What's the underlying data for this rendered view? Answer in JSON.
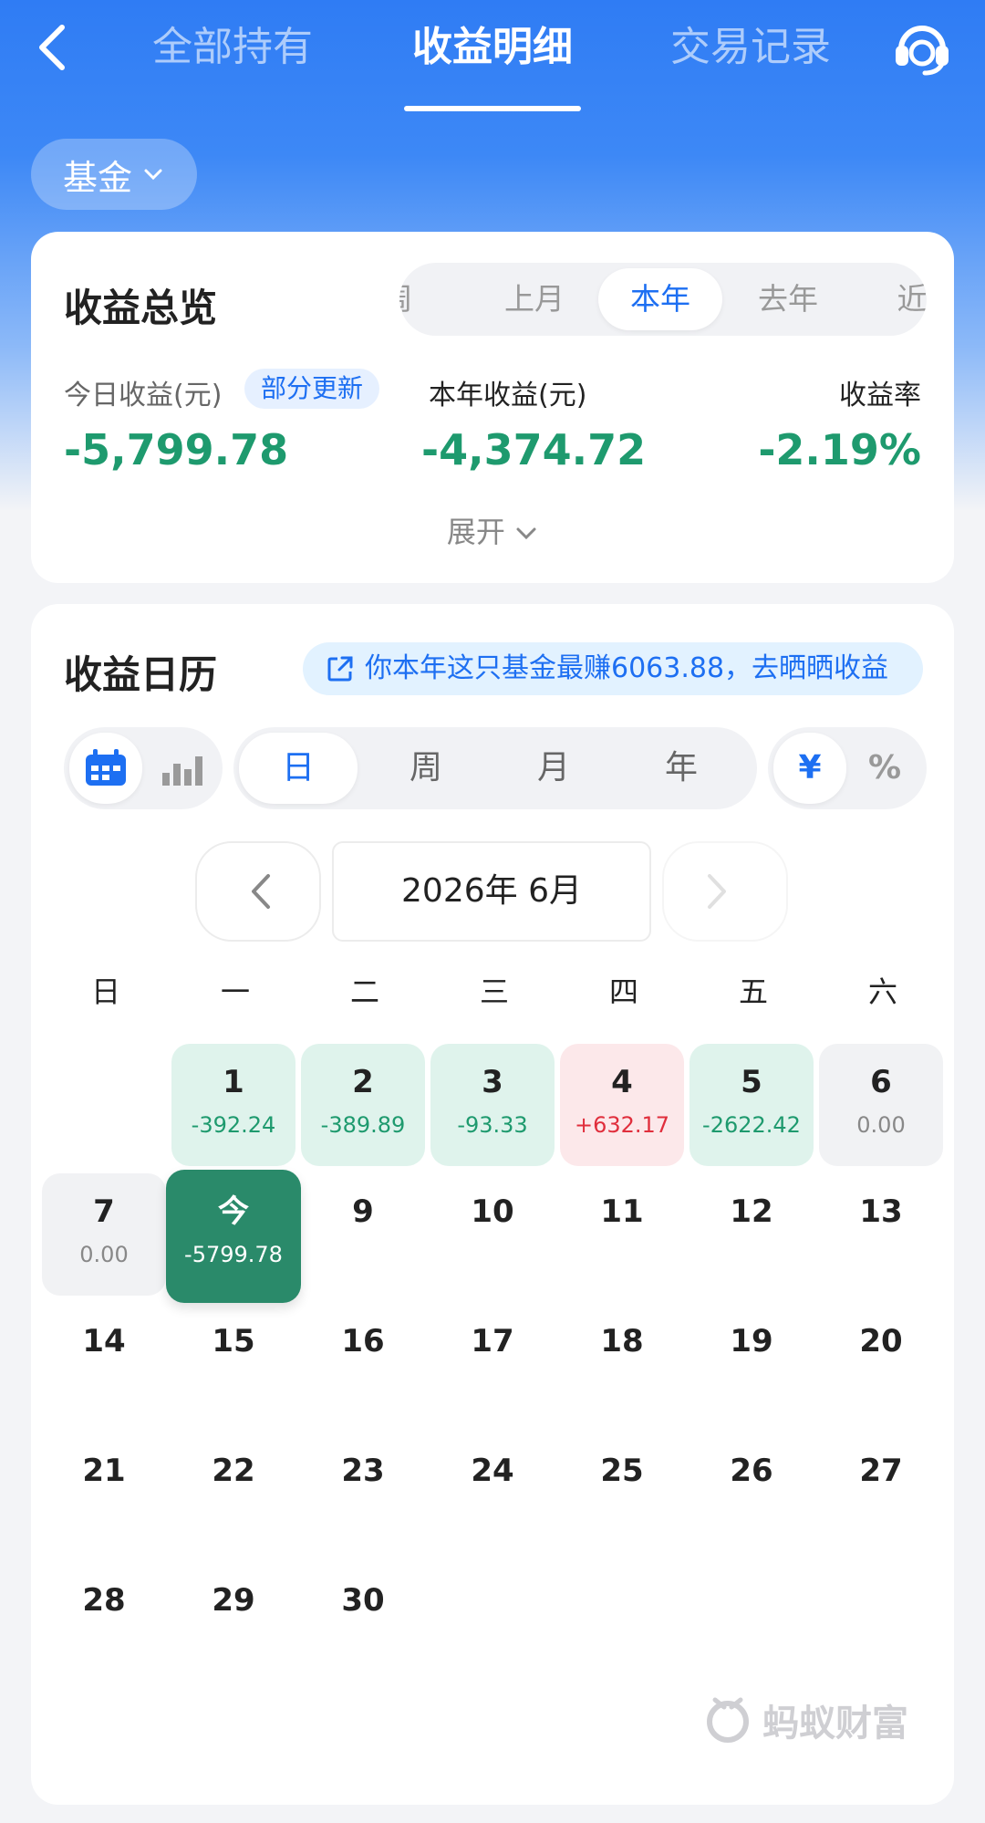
{
  "nav": {
    "tabs": [
      "全部持有",
      "收益明细",
      "交易记录"
    ],
    "active_tab": "收益明细"
  },
  "filter": {
    "label": "基金"
  },
  "overview": {
    "title": "收益总览",
    "periods": [
      "周",
      "上月",
      "本年",
      "去年",
      "近"
    ],
    "active_period": "本年",
    "today_label": "今日收益(元)",
    "badge": "部分更新",
    "today_value": "-5,799.78",
    "year_label": "本年收益(元)",
    "year_value": "-4,374.72",
    "rate_label": "收益率",
    "rate_value": "-2.19%",
    "expand": "展开"
  },
  "calendar": {
    "title": "收益日历",
    "share_text": "你本年这只基金最赚6063.88，去晒晒收益",
    "granularity": [
      "日",
      "周",
      "月",
      "年"
    ],
    "active_granularity": "日",
    "unit_options": [
      "¥",
      "%"
    ],
    "active_unit": "¥",
    "month_label": "2026年 6月",
    "weekdays": [
      "日",
      "一",
      "二",
      "三",
      "四",
      "五",
      "六"
    ],
    "days": [
      {
        "d": "1",
        "v": "-392.24",
        "status": "loss"
      },
      {
        "d": "2",
        "v": "-389.89",
        "status": "loss"
      },
      {
        "d": "3",
        "v": "-93.33",
        "status": "loss"
      },
      {
        "d": "4",
        "v": "+632.17",
        "status": "gain"
      },
      {
        "d": "5",
        "v": "-2622.42",
        "status": "loss"
      },
      {
        "d": "6",
        "v": "0.00",
        "status": "zero"
      },
      {
        "d": "7",
        "v": "0.00",
        "status": "zero"
      },
      {
        "d": "今",
        "v": "-5799.78",
        "status": "today"
      },
      {
        "d": "9"
      },
      {
        "d": "10"
      },
      {
        "d": "11"
      },
      {
        "d": "12"
      },
      {
        "d": "13"
      },
      {
        "d": "14"
      },
      {
        "d": "15"
      },
      {
        "d": "16"
      },
      {
        "d": "17"
      },
      {
        "d": "18"
      },
      {
        "d": "19"
      },
      {
        "d": "20"
      },
      {
        "d": "21"
      },
      {
        "d": "22"
      },
      {
        "d": "23"
      },
      {
        "d": "24"
      },
      {
        "d": "25"
      },
      {
        "d": "26"
      },
      {
        "d": "27"
      },
      {
        "d": "28"
      },
      {
        "d": "29"
      },
      {
        "d": "30"
      }
    ]
  },
  "watermark": "蚂蚁财富",
  "colors": {
    "brand_blue": "#1d6ff2",
    "loss_green": "#1e9a6e",
    "gain_red": "#e02e3c",
    "today_bg": "#2a8a6a"
  }
}
